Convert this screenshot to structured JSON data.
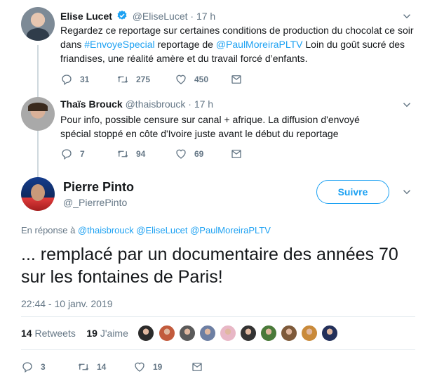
{
  "tweets": [
    {
      "name": "Elise Lucet",
      "handle": "@EliseLucet",
      "time": "· 17 h",
      "text_parts": {
        "a": "Regardez ce reportage sur certaines conditions de production du chocolat ce soir dans ",
        "b": "#EnvoyeSpecial",
        "c": " reportage de ",
        "d": "@PaulMoreiraPLTV",
        "e": " Loin du goût sucré des friandises, une réalité amère et du travail forcé d’enfants."
      },
      "replies": "31",
      "retweets": "275",
      "likes": "450"
    },
    {
      "name": "Thaïs Brouck",
      "handle": "@thaisbrouck",
      "time": "· 17 h",
      "text": "Pour info, possible censure sur canal + afrique. La diffusion d'envoyé spécial stoppé en côte d'Ivoire juste avant le début du reportage",
      "replies": "7",
      "retweets": "94",
      "likes": "69"
    }
  ],
  "main": {
    "name": "Pierre Pinto",
    "handle": "@_PierrePinto",
    "follow_label": "Suivre",
    "reply_prefix": "En réponse à",
    "reply_handles": [
      "@thaisbrouck",
      "@EliseLucet",
      "@PaulMoreiraPLTV"
    ],
    "text": "... remplacé par un documentaire des années 70 sur les fontaines de Paris!",
    "timestamp": "22:44 - 10 janv. 2019",
    "retweets_count": "14",
    "retweets_label": "Retweets",
    "likes_count": "19",
    "likes_label": "J'aime",
    "replies": "3",
    "retweets": "14",
    "likes": "19"
  },
  "colors": {
    "accent": "#1da1f2",
    "text": "#14171a",
    "muted": "#657786",
    "liker_avatars": [
      "#2b2b2b",
      "#c25b3d",
      "#5a5a5a",
      "#6d7fa3",
      "#e8b7c6",
      "#333333",
      "#4a7a3a",
      "#7e5a3a",
      "#c98a3a",
      "#23305a"
    ]
  }
}
